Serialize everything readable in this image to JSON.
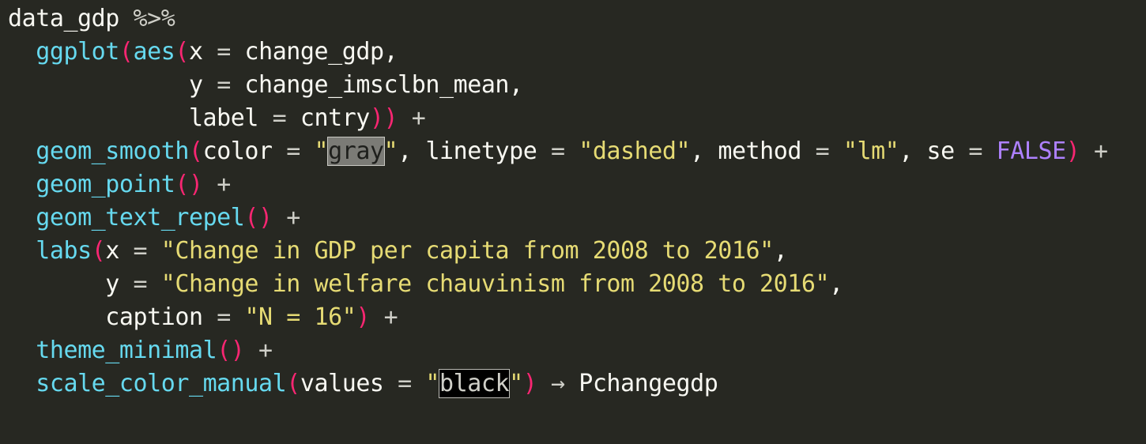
{
  "editor": {
    "background": "#272822",
    "lines": [
      {
        "tokens": [
          {
            "t": "data_gdp ",
            "c": "plain"
          },
          {
            "t": "%>%",
            "c": "op"
          }
        ]
      },
      {
        "tokens": [
          {
            "t": "  ",
            "c": "plain"
          },
          {
            "t": "ggplot",
            "c": "fn"
          },
          {
            "t": "(",
            "c": "paren"
          },
          {
            "t": "aes",
            "c": "fn"
          },
          {
            "t": "(",
            "c": "paren"
          },
          {
            "t": "x ",
            "c": "plain"
          },
          {
            "t": "=",
            "c": "op"
          },
          {
            "t": " change_gdp,",
            "c": "plain"
          }
        ]
      },
      {
        "tokens": [
          {
            "t": "             y ",
            "c": "plain"
          },
          {
            "t": "=",
            "c": "op"
          },
          {
            "t": " change_imsclbn_mean,",
            "c": "plain"
          }
        ]
      },
      {
        "tokens": [
          {
            "t": "             label ",
            "c": "plain"
          },
          {
            "t": "=",
            "c": "op"
          },
          {
            "t": " cntry",
            "c": "plain"
          },
          {
            "t": "))",
            "c": "paren"
          },
          {
            "t": " ",
            "c": "plain"
          },
          {
            "t": "+",
            "c": "op"
          }
        ]
      },
      {
        "tokens": [
          {
            "t": "  ",
            "c": "plain"
          },
          {
            "t": "geom_smooth",
            "c": "fn"
          },
          {
            "t": "(",
            "c": "paren"
          },
          {
            "t": "color ",
            "c": "plain"
          },
          {
            "t": "=",
            "c": "op"
          },
          {
            "t": " ",
            "c": "plain"
          },
          {
            "t": "\"",
            "c": "str"
          },
          {
            "t": "gray",
            "c": "sel-gray"
          },
          {
            "t": "\"",
            "c": "str"
          },
          {
            "t": ", linetype ",
            "c": "plain"
          },
          {
            "t": "=",
            "c": "op"
          },
          {
            "t": " ",
            "c": "plain"
          },
          {
            "t": "\"dashed\"",
            "c": "str"
          },
          {
            "t": ", method ",
            "c": "plain"
          },
          {
            "t": "=",
            "c": "op"
          },
          {
            "t": " ",
            "c": "plain"
          },
          {
            "t": "\"lm\"",
            "c": "str"
          },
          {
            "t": ", se ",
            "c": "plain"
          },
          {
            "t": "=",
            "c": "op"
          },
          {
            "t": " ",
            "c": "plain"
          },
          {
            "t": "FALSE",
            "c": "const"
          },
          {
            "t": ")",
            "c": "paren"
          },
          {
            "t": " ",
            "c": "plain"
          },
          {
            "t": "+",
            "c": "op"
          }
        ]
      },
      {
        "tokens": [
          {
            "t": "  ",
            "c": "plain"
          },
          {
            "t": "geom_point",
            "c": "fn"
          },
          {
            "t": "()",
            "c": "paren"
          },
          {
            "t": " ",
            "c": "plain"
          },
          {
            "t": "+",
            "c": "op"
          }
        ]
      },
      {
        "tokens": [
          {
            "t": "  ",
            "c": "plain"
          },
          {
            "t": "geom_text_repel",
            "c": "fn"
          },
          {
            "t": "()",
            "c": "paren"
          },
          {
            "t": " ",
            "c": "plain"
          },
          {
            "t": "+",
            "c": "op"
          }
        ]
      },
      {
        "tokens": [
          {
            "t": "  ",
            "c": "plain"
          },
          {
            "t": "labs",
            "c": "fn"
          },
          {
            "t": "(",
            "c": "paren"
          },
          {
            "t": "x ",
            "c": "plain"
          },
          {
            "t": "=",
            "c": "op"
          },
          {
            "t": " ",
            "c": "plain"
          },
          {
            "t": "\"Change in GDP per capita from 2008 to 2016\"",
            "c": "str"
          },
          {
            "t": ",",
            "c": "plain"
          }
        ]
      },
      {
        "tokens": [
          {
            "t": "       y ",
            "c": "plain"
          },
          {
            "t": "=",
            "c": "op"
          },
          {
            "t": " ",
            "c": "plain"
          },
          {
            "t": "\"Change in welfare chauvinism from 2008 to 2016\"",
            "c": "str"
          },
          {
            "t": ",",
            "c": "plain"
          }
        ]
      },
      {
        "tokens": [
          {
            "t": "       caption ",
            "c": "plain"
          },
          {
            "t": "=",
            "c": "op"
          },
          {
            "t": " ",
            "c": "plain"
          },
          {
            "t": "\"N = 16\"",
            "c": "str"
          },
          {
            "t": ")",
            "c": "paren"
          },
          {
            "t": " ",
            "c": "plain"
          },
          {
            "t": "+",
            "c": "op"
          }
        ]
      },
      {
        "tokens": [
          {
            "t": "  ",
            "c": "plain"
          },
          {
            "t": "theme_minimal",
            "c": "fn"
          },
          {
            "t": "()",
            "c": "paren"
          },
          {
            "t": " ",
            "c": "plain"
          },
          {
            "t": "+",
            "c": "op"
          }
        ]
      },
      {
        "tokens": [
          {
            "t": "  ",
            "c": "plain"
          },
          {
            "t": "scale_color_manual",
            "c": "fn"
          },
          {
            "t": "(",
            "c": "paren"
          },
          {
            "t": "values ",
            "c": "plain"
          },
          {
            "t": "=",
            "c": "op"
          },
          {
            "t": " ",
            "c": "plain"
          },
          {
            "t": "\"",
            "c": "str"
          },
          {
            "t": "black",
            "c": "sel-black"
          },
          {
            "t": "\"",
            "c": "str"
          },
          {
            "t": ")",
            "c": "paren"
          },
          {
            "t": " ",
            "c": "plain"
          },
          {
            "t": "→",
            "c": "op"
          },
          {
            "t": " Pchangegdp",
            "c": "plain"
          }
        ]
      }
    ]
  }
}
